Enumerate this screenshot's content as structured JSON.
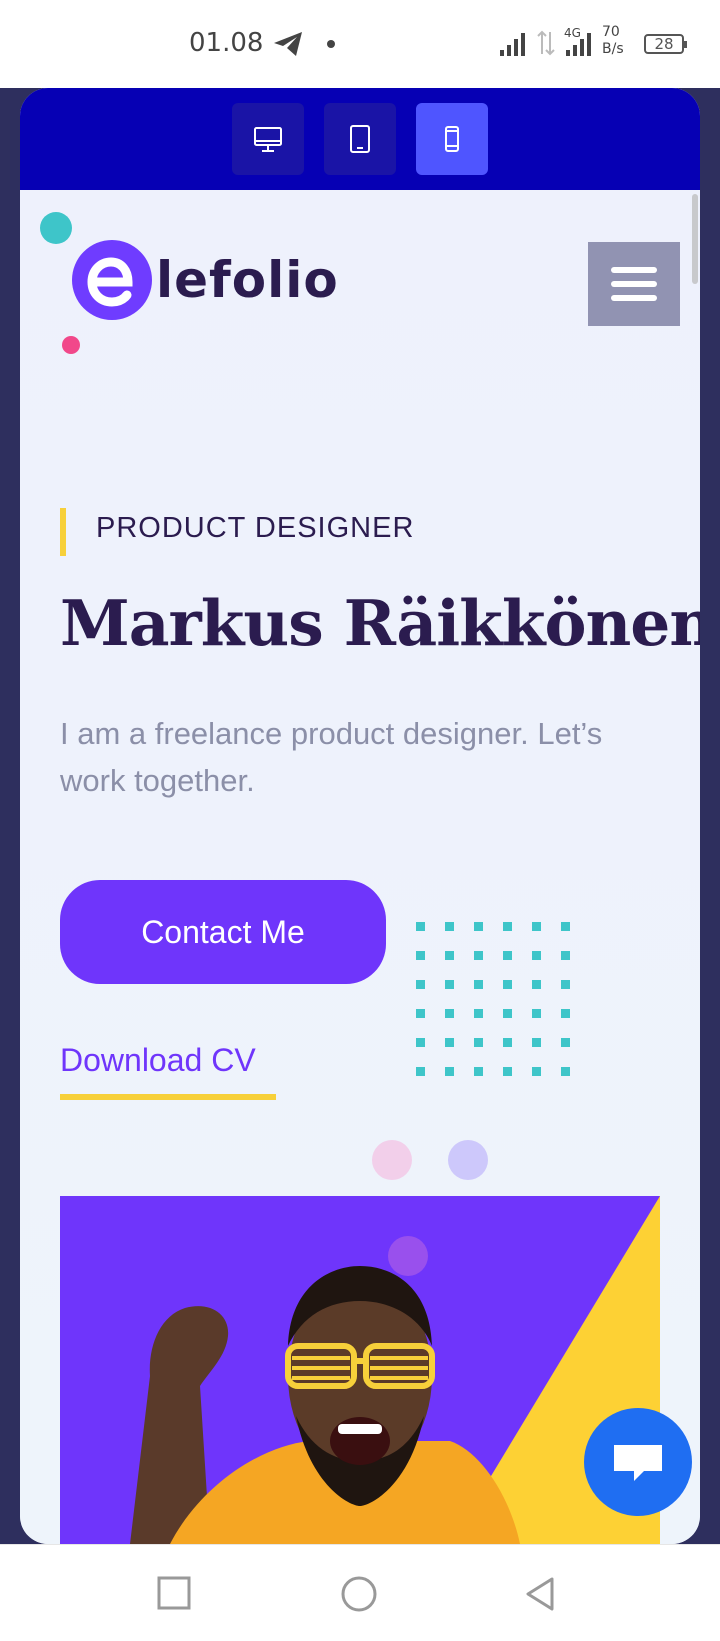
{
  "status_bar": {
    "time": "01.08",
    "network": "4G",
    "speed_value": "70",
    "speed_unit": "B/s",
    "battery": "28"
  },
  "device_switcher": {
    "options": [
      "desktop-icon",
      "tablet-icon",
      "mobile-icon"
    ],
    "active": "mobile"
  },
  "site": {
    "logo_text": "lefolio",
    "role": "PRODUCT DESIGNER",
    "name": "Markus Räikkönen",
    "tagline": "I am a freelance product designer. Let’s work together.",
    "contact_label": "Contact Me",
    "download_label": "Download CV"
  },
  "colors": {
    "primary": "#6f35fb",
    "accent_yellow": "#f7d03a",
    "heading": "#2b1c4f",
    "device_bar": "#0600b4",
    "chat": "#1f6ef2",
    "teal": "#3ec5c9"
  },
  "icons": {
    "menu": "hamburger-icon",
    "chat": "chat-icon",
    "nav": [
      "recent-apps-icon",
      "home-icon",
      "back-icon"
    ]
  }
}
